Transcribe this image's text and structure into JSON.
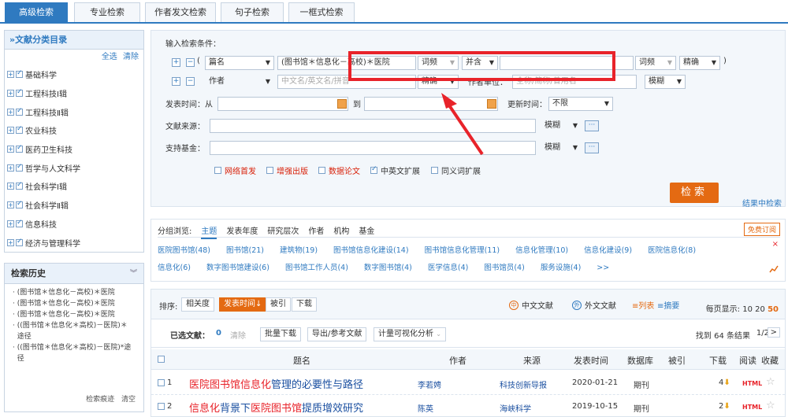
{
  "tabs": [
    "高级检索",
    "专业检索",
    "作者发文检索",
    "句子检索",
    "一框式检索"
  ],
  "sidebar": {
    "title": "»文献分类目录",
    "select_all": "全选",
    "clear": "清除",
    "categories": [
      "基础科学",
      "工程科技Ⅰ辑",
      "工程科技Ⅱ辑",
      "农业科技",
      "医药卫生科技",
      "哲学与人文科学",
      "社会科学Ⅰ辑",
      "社会科学Ⅱ辑",
      "信息科技",
      "经济与管理科学"
    ]
  },
  "history": {
    "title": "检索历史",
    "items": [
      "(图书馆＊信息化－高校)＊医院",
      "(图书馆＊信息化－高校)＊医院",
      "(图书馆＊信息化－高校)＊医院",
      "((图书馆＊信息化＊高校)－医院)＊",
      "途径",
      "((图书馆＊信息化＊高校)－医院)*途",
      "径"
    ],
    "trace": "检索痕迹",
    "clear": "清空"
  },
  "search": {
    "conditions_label": "输入检索条件：",
    "plus": "+",
    "minus": "−",
    "row1": {
      "paren_open": "(",
      "field": "篇名",
      "query": "(图书馆＊信息化－高校)＊医院",
      "term_freq": "词频",
      "logic": "并含",
      "term_freq2": "词频",
      "precise": "精确",
      "paren_close": ")"
    },
    "row2": {
      "field": "作者",
      "author_placeholder": "中文名/英文名/拼音",
      "precise": "精确",
      "org_label": "作者单位：",
      "org_placeholder": "全称/简称/曾用名",
      "fuzzy": "模糊"
    },
    "date": {
      "label": "发表时间：从",
      "to": "到",
      "update_label": "更新时间：",
      "update_value": "不限"
    },
    "source": {
      "label": "文献来源：",
      "fuzzy": "模糊"
    },
    "fund": {
      "label": "支持基金：",
      "fuzzy": "模糊"
    },
    "dots": "···",
    "extensions": [
      {
        "label": "网络首发",
        "checked": false,
        "color": "#d81e06"
      },
      {
        "label": "增强出版",
        "checked": false,
        "color": "#d81e06"
      },
      {
        "label": "数据论文",
        "checked": false,
        "color": "#d81e06"
      },
      {
        "label": "中英文扩展",
        "checked": true,
        "color": "#333333"
      },
      {
        "label": "同义词扩展",
        "checked": false,
        "color": "#333333"
      }
    ],
    "button": "检索",
    "in_results": "结果中检索"
  },
  "filters": {
    "label": "分组浏览:",
    "tabs": [
      "主题",
      "发表年度",
      "研究层次",
      "作者",
      "机构",
      "基金"
    ],
    "subscribe": "免费订阅",
    "row1": [
      "医院图书馆(48)",
      "图书馆(21)",
      "建筑物(19)",
      "图书馆信息化建设(14)",
      "图书馆信息化管理(11)",
      "信息化管理(10)",
      "信息化建设(9)",
      "医院信息化(8)"
    ],
    "row2": [
      "信息化(6)",
      "数字图书馆建设(6)",
      "图书馆工作人员(4)",
      "数字图书馆(4)",
      "医学信息(4)",
      "图书馆员(4)",
      "服务设施(4)",
      ">>"
    ],
    "close": "×"
  },
  "results": {
    "sort_label": "排序:",
    "sorts": [
      "相关度",
      "发表时间↓",
      "被引",
      "下载"
    ],
    "lang_cn": "中文文献",
    "lang_en": "外文文献",
    "view_list": "≡列表",
    "view_abstract": "≡摘要",
    "per_page_label": "每页显示:",
    "per_page": [
      "10",
      "20",
      "50"
    ],
    "selected_label": "已选文献：",
    "selected_count": "0",
    "clear": "清除",
    "batch_download": "批量下载",
    "export": "导出/参考文献",
    "visual": "计量可视化分析",
    "found": "找到 64 条结果",
    "page": "1/2",
    "next": ">",
    "columns": [
      "题名",
      "作者",
      "来源",
      "发表时间",
      "数据库",
      "被引",
      "下载",
      "阅读",
      "收藏"
    ],
    "rows": [
      {
        "num": "1",
        "title_parts": [
          "医院图书馆信息化",
          "管理的必要性与路径"
        ],
        "author": "李若娉",
        "source": "科技创新导报",
        "date": "2020-01-21",
        "db": "期刊",
        "cited": "",
        "downloads": "4",
        "read": "HTML"
      },
      {
        "num": "2",
        "title_parts": [
          "信息化",
          "背景下",
          "医院图书馆",
          "提质增效研究"
        ],
        "author": "陈英",
        "source": "海峡科学",
        "date": "2019-10-15",
        "db": "期刊",
        "cited": "",
        "downloads": "2",
        "read": "HTML"
      }
    ]
  },
  "colors": {
    "brand_blue": "#2f7ac0",
    "accent_orange": "#e46a12",
    "highlight_red": "#e8232a"
  }
}
